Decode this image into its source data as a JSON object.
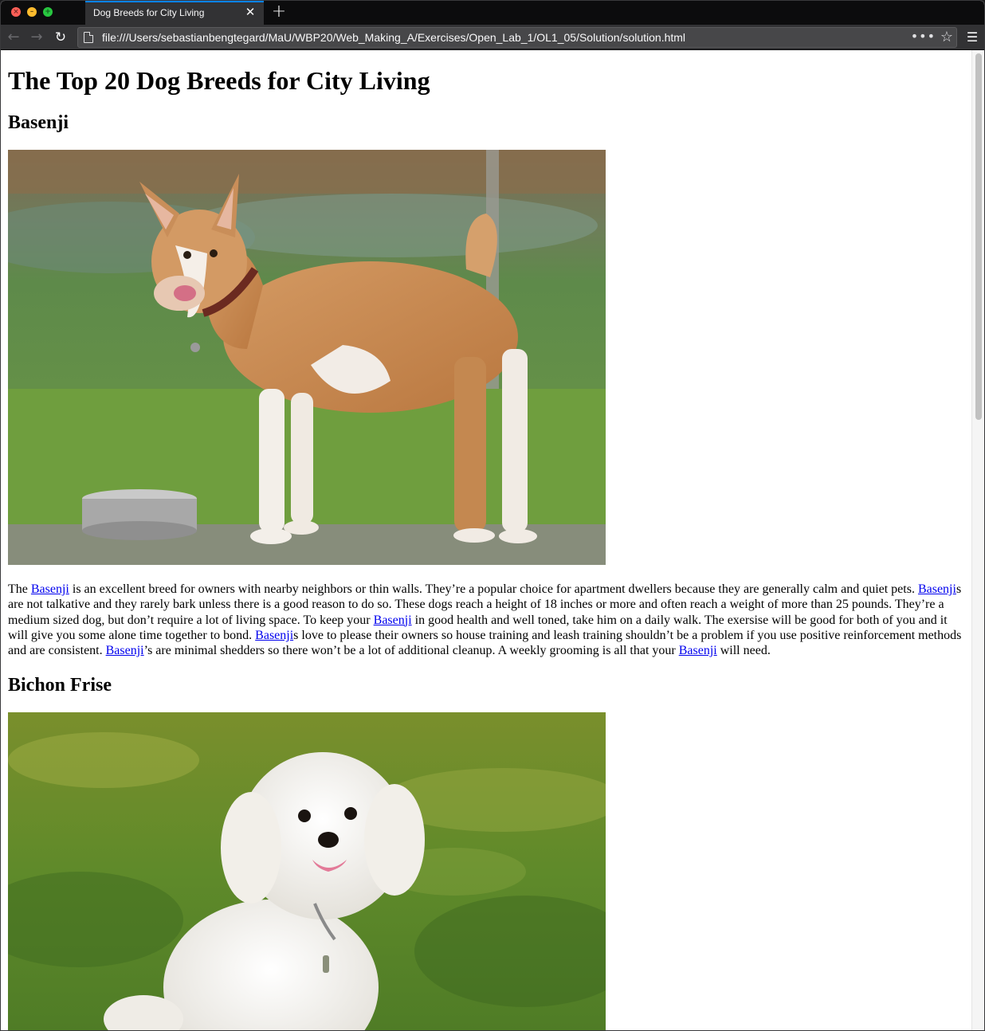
{
  "browser": {
    "tab_title": "Dog Breeds for City Living",
    "tab_close_icon": "close-icon",
    "new_tab_label": "+",
    "url": "file:///Users/sebastianbengtegard/MaU/WBP20/Web_Making_A/Exercises/Open_Lab_1/OL1_05/Solution/solution.html",
    "page_actions_label": "•••",
    "back_icon": "arrow-left-icon",
    "forward_icon": "arrow-right-icon",
    "reload_icon": "reload-icon",
    "bookmark_icon": "star-icon",
    "menu_icon": "hamburger-menu-icon"
  },
  "page": {
    "title": "The Top 20 Dog Breeds for City Living",
    "sections": [
      {
        "heading": "Basenji",
        "image_subject": "basenji-dog-photo",
        "paragraph": {
          "link_text": "Basenji",
          "t0": "The ",
          "t1": " is an excellent breed for owners with nearby neighbors or thin walls. They’re a popular choice for apartment dwellers because they are generally calm and quiet pets. ",
          "t2": "s are not talkative and they rarely bark unless there is a good reason to do so. These dogs reach a height of 18 inches or more and often reach a weight of more than 25 pounds. They’re a medium sized dog, but don’t require a lot of living space. To keep your ",
          "t3": " in good health and well toned, take him on a daily walk. The exersise will be good for both of you and it will give you some alone time together to bond. ",
          "t4": "s love to please their owners so house training and leash training shouldn’t be a problem if you use positive reinforcement methods and are consistent. ",
          "t5": "’s are minimal shedders so there won’t be a lot of additional cleanup. A weekly grooming is all that your ",
          "t6": " will need."
        }
      },
      {
        "heading": "Bichon Frise",
        "image_subject": "bichon-frise-dog-photo"
      }
    ]
  },
  "colors": {
    "link": "#0000ee",
    "tab_accent": "#0a84ff",
    "chrome_dark": "#0c0c0d",
    "chrome_mid": "#323234"
  }
}
